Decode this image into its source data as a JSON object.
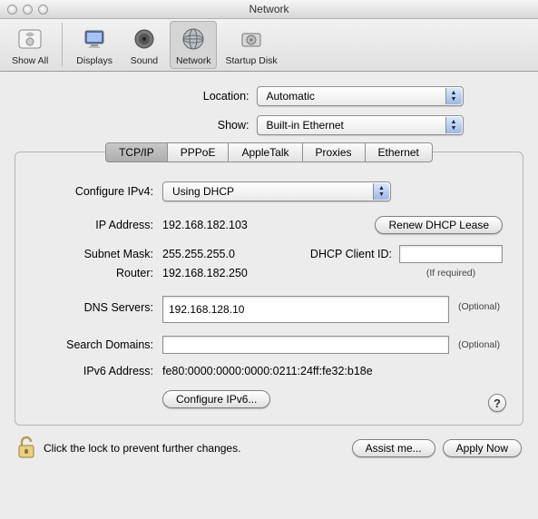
{
  "window": {
    "title": "Network"
  },
  "toolbar": {
    "show_all": "Show All",
    "displays": "Displays",
    "sound": "Sound",
    "network": "Network",
    "startup_disk": "Startup Disk"
  },
  "selectors": {
    "location_label": "Location:",
    "location_value": "Automatic",
    "show_label": "Show:",
    "show_value": "Built-in Ethernet"
  },
  "tabs": {
    "tcpip": "TCP/IP",
    "pppoe": "PPPoE",
    "appletalk": "AppleTalk",
    "proxies": "Proxies",
    "ethernet": "Ethernet"
  },
  "form": {
    "configure_label": "Configure IPv4:",
    "configure_value": "Using DHCP",
    "ip_label": "IP Address:",
    "ip_value": "192.168.182.103",
    "renew_btn": "Renew DHCP Lease",
    "subnet_label": "Subnet Mask:",
    "subnet_value": "255.255.255.0",
    "dhcp_client_label": "DHCP Client ID:",
    "dhcp_client_value": "",
    "dhcp_note": "(If required)",
    "router_label": "Router:",
    "router_value": "192.168.182.250",
    "dns_label": "DNS Servers:",
    "dns_value": "192.168.128.10",
    "optional": "(Optional)",
    "search_label": "Search Domains:",
    "search_value": "",
    "ipv6addr_label": "IPv6 Address:",
    "ipv6addr_value": "fe80:0000:0000:0000:0211:24ff:fe32:b18e",
    "configure_ipv6_btn": "Configure IPv6...",
    "help": "?"
  },
  "footer": {
    "lock_text": "Click the lock to prevent further changes.",
    "assist": "Assist me...",
    "apply": "Apply Now"
  }
}
